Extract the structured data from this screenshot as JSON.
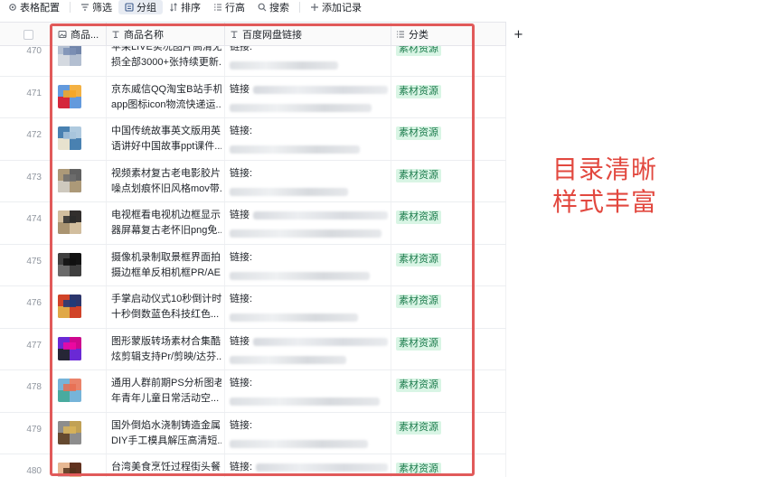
{
  "toolbar": {
    "items": [
      {
        "label": "表格配置",
        "icon": "gear-icon"
      },
      {
        "label": "筛选",
        "icon": "filter-icon"
      },
      {
        "label": "分组",
        "icon": "group-icon",
        "active": true
      },
      {
        "label": "排序",
        "icon": "sort-icon"
      },
      {
        "label": "行高",
        "icon": "row-height-icon"
      },
      {
        "label": "搜索",
        "icon": "search-icon"
      }
    ],
    "add_record": "添加记录"
  },
  "table": {
    "columns": [
      {
        "label": "商品...",
        "icon": "image-field-icon"
      },
      {
        "label": "商品名称",
        "icon": "text-field-icon"
      },
      {
        "label": "百度网盘链接",
        "icon": "text-field-icon"
      },
      {
        "label": "分类",
        "icon": "single-select-icon"
      }
    ],
    "add_column": "+",
    "rows": [
      {
        "num": "470",
        "name1": "苹果LIVE实况图片高清无",
        "name2": "损全部3000+张持续更新...",
        "link": "链接:",
        "tag": "素材资源"
      },
      {
        "num": "471",
        "name1": "京东威信QQ淘宝B站手机",
        "name2": "app图标icon物流快递运...",
        "link": "链接",
        "tag": "素材资源"
      },
      {
        "num": "472",
        "name1": "中国传统故事英文版用英",
        "name2": "语讲好中国故事ppt课件...",
        "link": "链接:",
        "tag": "素材资源"
      },
      {
        "num": "473",
        "name1": "视频素材复古老电影胶片",
        "name2": "噪点划痕怀旧风格mov带...",
        "link": "链接:",
        "tag": "素材资源"
      },
      {
        "num": "474",
        "name1": "电视框看电视机边框显示",
        "name2": "器屏幕复古老怀旧png免...",
        "link": "链接",
        "tag": "素材资源"
      },
      {
        "num": "475",
        "name1": "摄像机录制取景框界面拍",
        "name2": "摄边框单反相机框PR/AE...",
        "link": "链接:",
        "tag": "素材资源"
      },
      {
        "num": "476",
        "name1": "手掌启动仪式10秒倒计时",
        "name2": "十秒倒数蓝色科技红色...",
        "link": "链接:",
        "tag": "素材资源"
      },
      {
        "num": "477",
        "name1": "图形蒙版转场素材合集酷",
        "name2": "炫剪辑支持Pr/剪映/达芬...",
        "link": "链接",
        "tag": "素材资源"
      },
      {
        "num": "478",
        "name1": "通用人群前期PS分析图老",
        "name2": "年青年儿童日常活动空...",
        "link": "链接:",
        "tag": "素材资源"
      },
      {
        "num": "479",
        "name1": "国外倒焰水浇制铸造金属",
        "name2": "DIY手工模具解压高清短...",
        "link": "链接:",
        "tag": "素材资源"
      },
      {
        "num": "480",
        "name1": "台湾美食烹饪过程街头餐",
        "name2": "",
        "link": "链接:",
        "tag": "素材资源"
      }
    ]
  },
  "promo": {
    "line1": "目录清晰",
    "line2": "样式丰富",
    "color": "#e2483f"
  },
  "colors": {
    "tag_bg": "#d9f5e5",
    "tag_text": "#1d7c4d",
    "highlight": "#e15a5a"
  }
}
